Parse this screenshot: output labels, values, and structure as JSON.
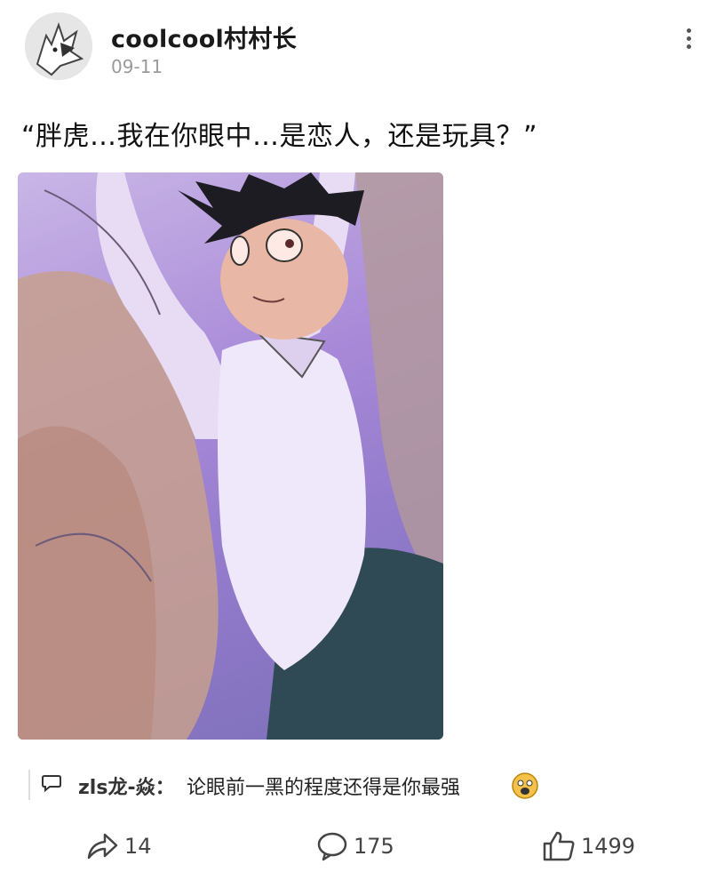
{
  "post": {
    "author": "coolcool村村长",
    "date": "09-11",
    "text": "“胖虎…我在你眼中…是恋人，还是玩具？”",
    "image_description_icon": "anime-illustration"
  },
  "top_comment": {
    "author": "zls龙-焱：",
    "text": "论眼前一黑的程度还得是你最强"
  },
  "actions": {
    "share_count": "14",
    "comment_count": "175",
    "like_count": "1499"
  },
  "colors": {
    "accent_text": "#111111",
    "meta_gray": "#9a9a9a",
    "icon_gray": "#555555"
  }
}
